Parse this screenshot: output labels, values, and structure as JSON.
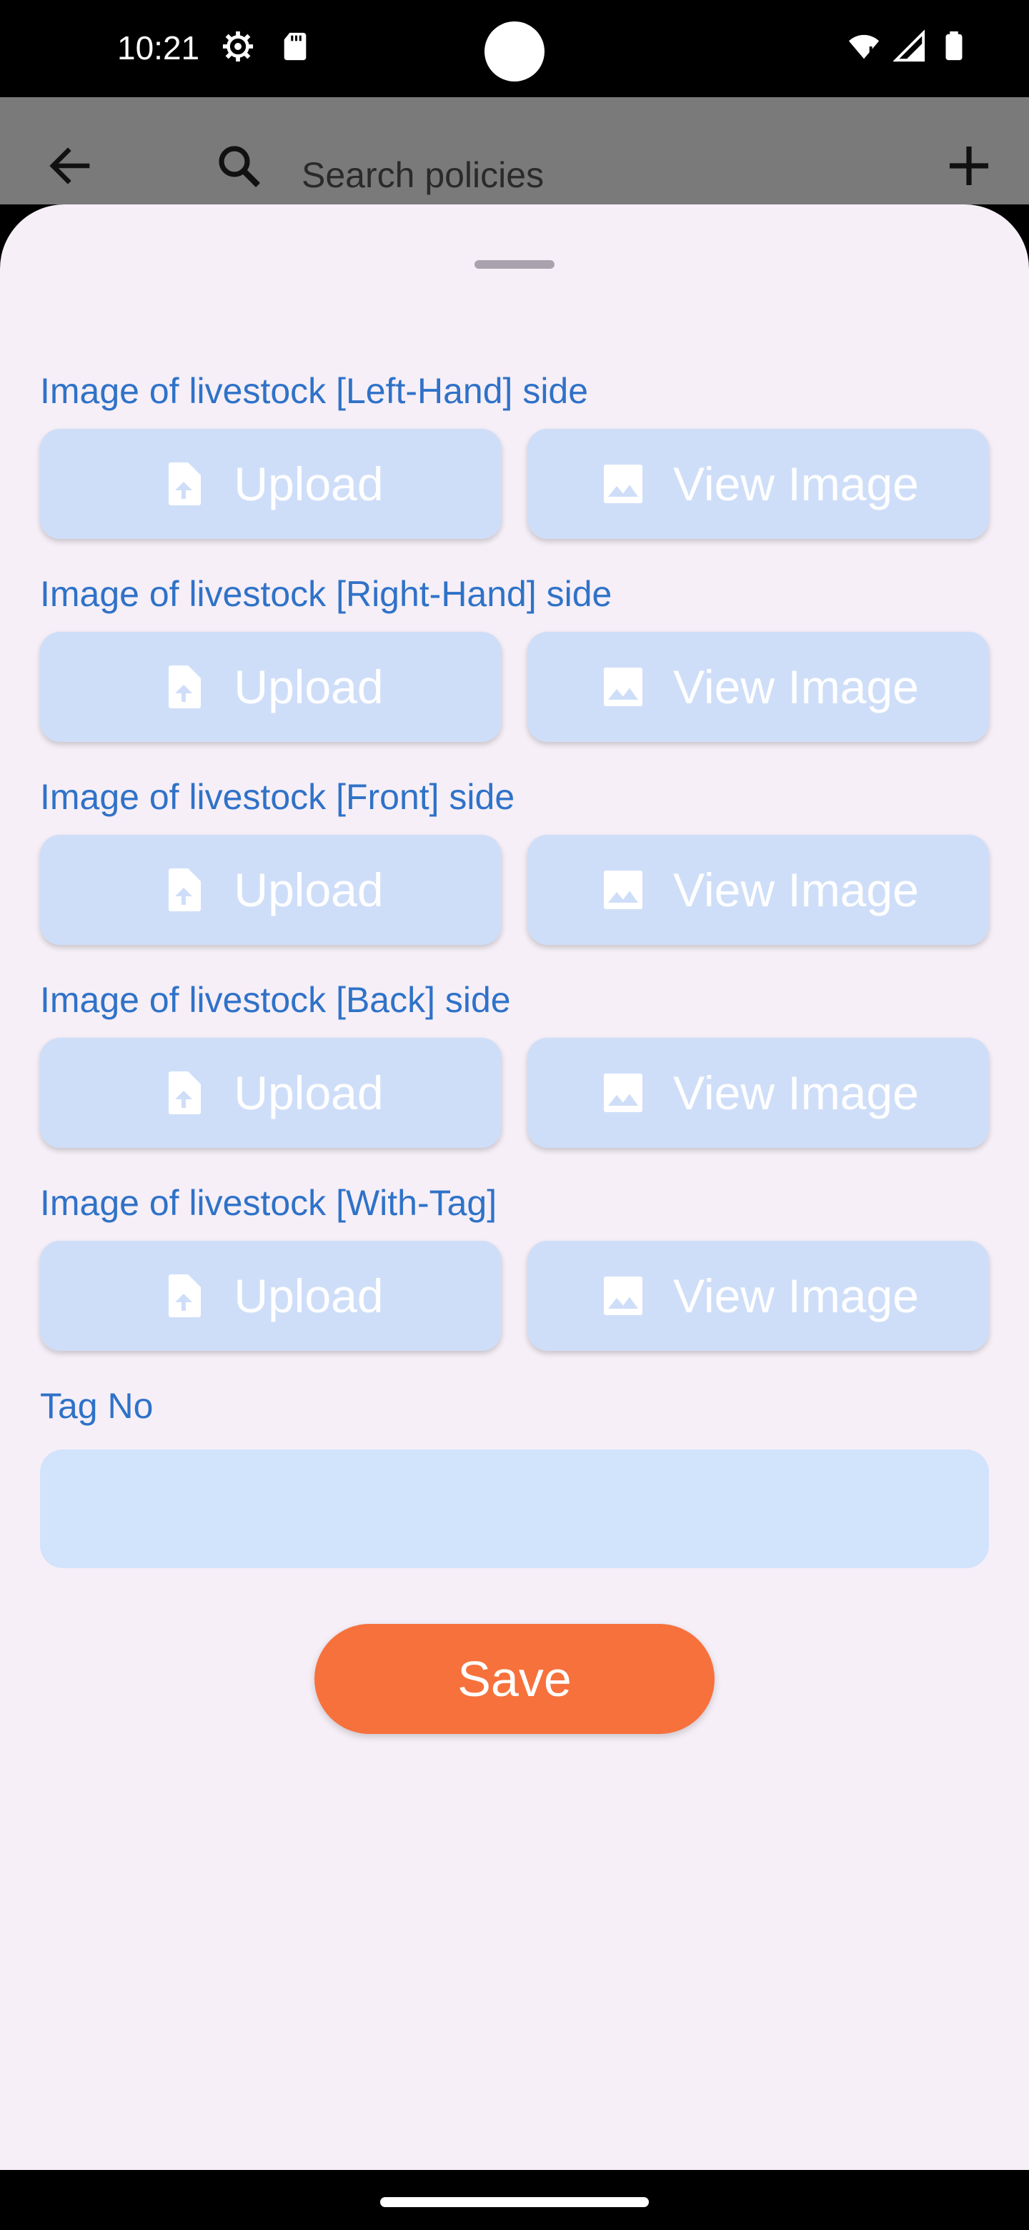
{
  "status_bar": {
    "time": "10:21"
  },
  "app_bar": {
    "search_placeholder": "Search policies"
  },
  "sections": [
    {
      "label": "Image of livestock [Left-Hand] side",
      "upload_label": "Upload",
      "view_label": "View Image"
    },
    {
      "label": "Image of livestock [Right-Hand] side",
      "upload_label": "Upload",
      "view_label": "View Image"
    },
    {
      "label": "Image of livestock [Front] side",
      "upload_label": "Upload",
      "view_label": "View Image"
    },
    {
      "label": "Image of livestock [Back] side",
      "upload_label": "Upload",
      "view_label": "View Image"
    },
    {
      "label": "Image of livestock [With-Tag]",
      "upload_label": "Upload",
      "view_label": "View Image"
    }
  ],
  "tag": {
    "label": "Tag No",
    "value": ""
  },
  "save_label": "Save",
  "colors": {
    "accent": "#2f72c8",
    "button_bg": "#cfdef8",
    "save": "#f7713c",
    "sheet": "#f6eff7"
  }
}
